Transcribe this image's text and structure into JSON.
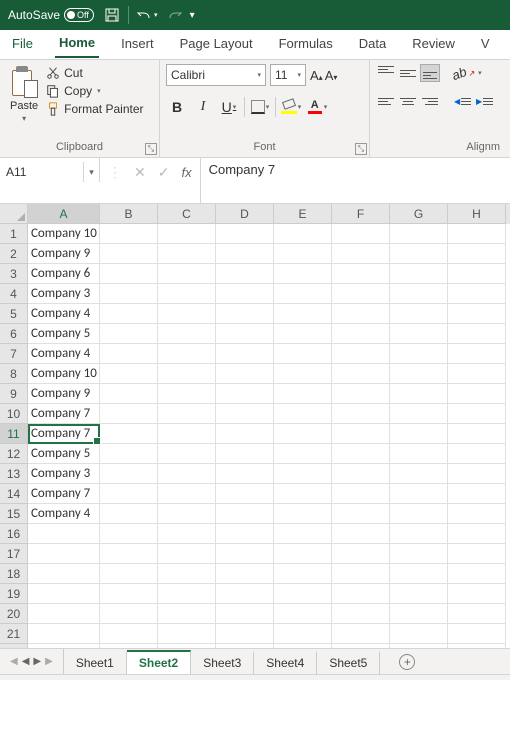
{
  "titlebar": {
    "autosave_label": "AutoSave",
    "autosave_state": "Off"
  },
  "tabs": {
    "file": "File",
    "items": [
      "Home",
      "Insert",
      "Page Layout",
      "Formulas",
      "Data",
      "Review",
      "V"
    ],
    "active": 0
  },
  "ribbon": {
    "clipboard": {
      "paste": "Paste",
      "cut": "Cut",
      "copy": "Copy",
      "format_painter": "Format Painter",
      "label": "Clipboard"
    },
    "font": {
      "name": "Calibri",
      "size": "11",
      "label": "Font",
      "bold": "B",
      "italic": "I",
      "underline": "U",
      "color_letter": "A",
      "grow": "A",
      "shrink": "A"
    },
    "alignment": {
      "label": "Alignm",
      "orient": "ab"
    }
  },
  "namebox": "A11",
  "formula_bar": "Company 7",
  "columns": [
    "A",
    "B",
    "C",
    "D",
    "E",
    "F",
    "G",
    "H"
  ],
  "selected_col": 0,
  "selected_row": 11,
  "sheet_tabs": [
    "Sheet1",
    "Sheet2",
    "Sheet3",
    "Sheet4",
    "Sheet5"
  ],
  "active_sheet": 1,
  "chart_data": {
    "type": "table",
    "columns": [
      "A"
    ],
    "rows": [
      [
        "Company 10"
      ],
      [
        "Company 9"
      ],
      [
        "Company 6"
      ],
      [
        "Company 3"
      ],
      [
        "Company 4"
      ],
      [
        "Company 5"
      ],
      [
        "Company 4"
      ],
      [
        "Company 10"
      ],
      [
        "Company 9"
      ],
      [
        "Company 7"
      ],
      [
        "Company 7"
      ],
      [
        "Company 5"
      ],
      [
        "Company 3"
      ],
      [
        "Company 7"
      ],
      [
        "Company 4"
      ],
      [
        ""
      ],
      [
        ""
      ],
      [
        ""
      ],
      [
        ""
      ],
      [
        ""
      ],
      [
        ""
      ],
      [
        ""
      ]
    ]
  }
}
